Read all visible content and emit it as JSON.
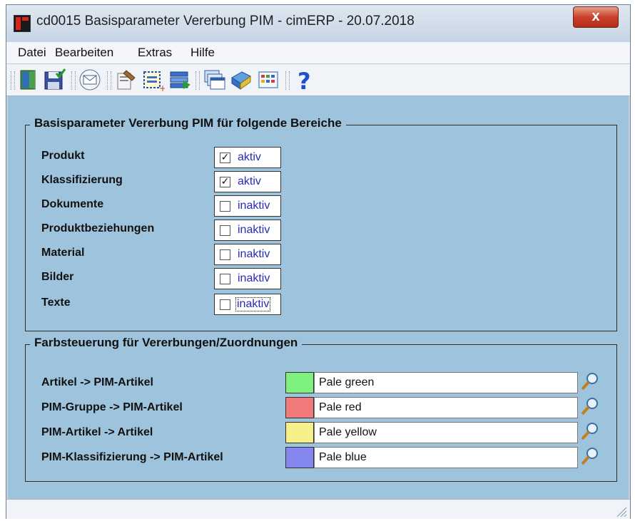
{
  "window": {
    "title": "cd0015 Basisparameter Vererbung PIM - cimERP - 20.07.2018",
    "close_label": "x"
  },
  "menu": [
    "Datei",
    "Bearbeiten",
    "Extras",
    "Hilfe"
  ],
  "toolbar": [
    "exit-icon",
    "save-icon",
    "mail-icon",
    "edit-icon",
    "select-icon",
    "list-icon",
    "windows-icon",
    "book-icon",
    "grid-icon",
    "help-icon"
  ],
  "group1": {
    "title": "Basisparameter Vererbung PIM für folgende Bereiche",
    "rows": [
      {
        "label": "Produkt",
        "checked": true,
        "state": "aktiv"
      },
      {
        "label": "Klassifizierung",
        "checked": true,
        "state": "aktiv"
      },
      {
        "label": "Dokumente",
        "checked": false,
        "state": "inaktiv"
      },
      {
        "label": "Produktbeziehungen",
        "checked": false,
        "state": "inaktiv"
      },
      {
        "label": "Material",
        "checked": false,
        "state": "inaktiv"
      },
      {
        "label": "Bilder",
        "checked": false,
        "state": "inaktiv"
      },
      {
        "label": "Texte",
        "checked": false,
        "state": "inaktiv"
      }
    ]
  },
  "group2": {
    "title": "Farbsteuerung für Vererbungen/Zuordnungen",
    "rows": [
      {
        "label": "Artikel -> PIM-Artikel",
        "color_name": "Pale green",
        "color": "#7ef07e"
      },
      {
        "label": "PIM-Gruppe -> PIM-Artikel",
        "color_name": "Pale red",
        "color": "#f27a7a"
      },
      {
        "label": "PIM-Artikel -> Artikel",
        "color_name": "Pale yellow",
        "color": "#f7f08a"
      },
      {
        "label": "PIM-Klassifizierung -> PIM-Artikel",
        "color_name": "Pale blue",
        "color": "#8486f0"
      }
    ]
  }
}
